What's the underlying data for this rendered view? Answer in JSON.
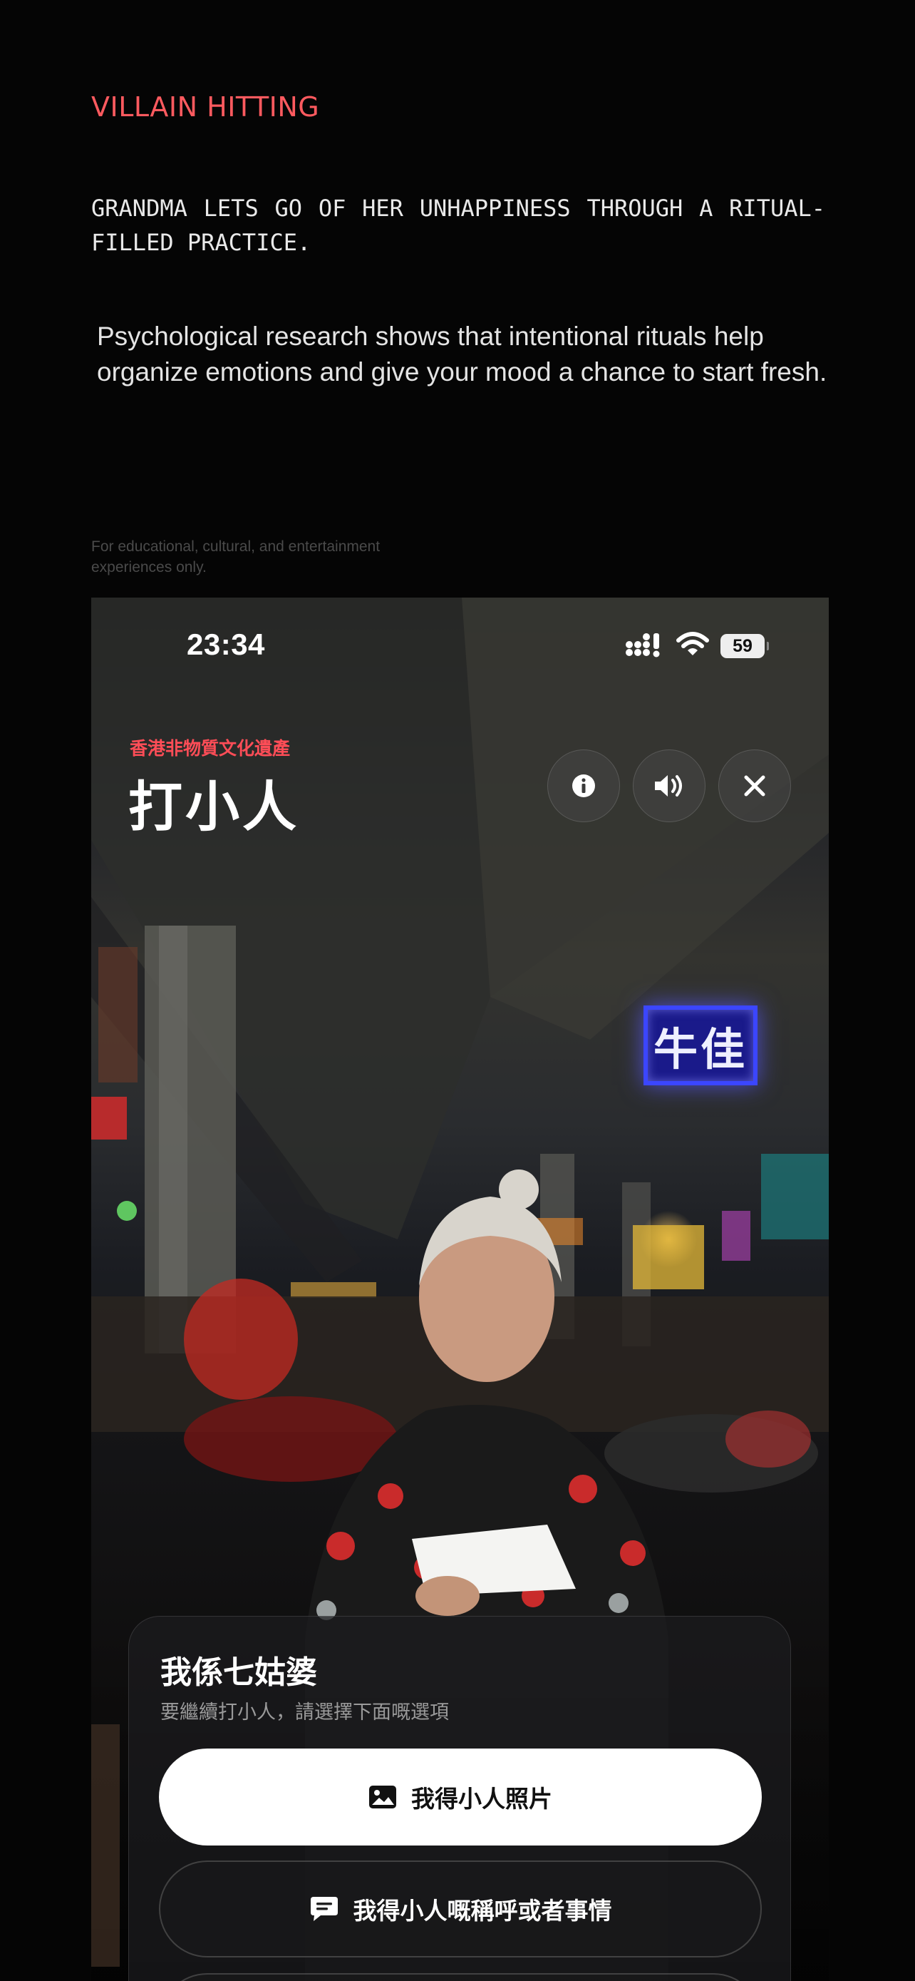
{
  "intro": {
    "kicker": "VILLAIN HITTING",
    "headline": "GRANDMA LETS GO OF HER UNHAPPINESS THROUGH A RITUAL-FILLED PRACTICE.",
    "body": "Psychological research shows that intentional rituals help organize emotions and give your mood a chance to start fresh.",
    "disclaimer": "For educational, cultural, and entertainment experiences only."
  },
  "colors": {
    "accent_red": "#ff5a5f",
    "heritage_red": "#ff4d57",
    "background": "#050505"
  },
  "phone": {
    "status_bar": {
      "time": "23:34",
      "battery": "59",
      "icons": [
        "signal-icon",
        "wifi-icon",
        "battery-icon"
      ]
    },
    "header": {
      "heritage_label": "香港非物質文化遺產",
      "title": "打小人",
      "buttons": [
        "info-icon",
        "speaker-icon",
        "close-icon"
      ]
    },
    "scene": {
      "neon_sign": "牛佳"
    },
    "card": {
      "title": "我係七姑婆",
      "subtitle": "要繼續打小人，請選擇下面嘅選項",
      "options": [
        {
          "label": "我得小人照片",
          "icon": "image-icon"
        },
        {
          "label": "我得小人嘅稱呼或者事情",
          "icon": "chat-icon"
        }
      ]
    }
  }
}
